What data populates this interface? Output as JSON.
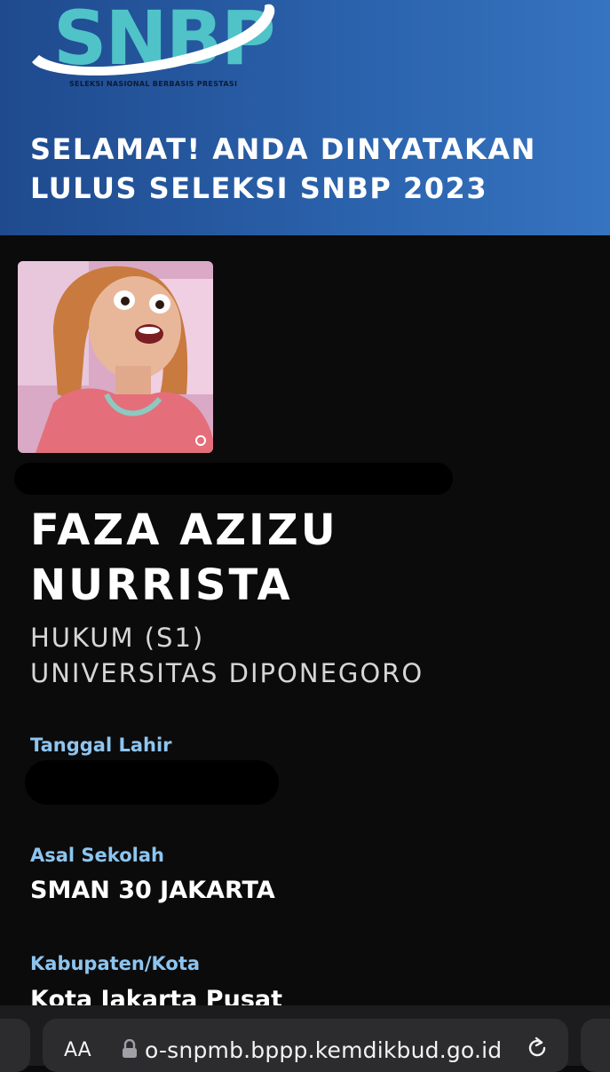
{
  "header": {
    "logo_text": "SNBP",
    "logo_subtitle": "SELEKSI NASIONAL BERBASIS PRESTASI",
    "headline_line1": "SELAMAT! ANDA DINYATAKAN",
    "headline_line2": "LULUS SELEKSI SNBP 2023",
    "colors": {
      "gradient_start": "#1f4a8e",
      "gradient_end": "#3673c0",
      "logo_teal": "#4fc3c8"
    }
  },
  "profile": {
    "name_line1": "FAZA AZIZU",
    "name_line2": "NURRISTA",
    "program": "HUKUM (S1)",
    "university": "UNIVERSITAS DIPONEGORO"
  },
  "details": {
    "birth_label": "Tanggal Lahir",
    "school_label": "Asal Sekolah",
    "school_value": "SMAN 30 JAKARTA",
    "city_label": "Kabupaten/Kota",
    "city_value": "Kota Jakarta Pusat",
    "label_color": "#8ec5ef"
  },
  "browser": {
    "text_size_label": "AA",
    "url": "o-snpmb.bppp.kemdikbud.go.id"
  }
}
